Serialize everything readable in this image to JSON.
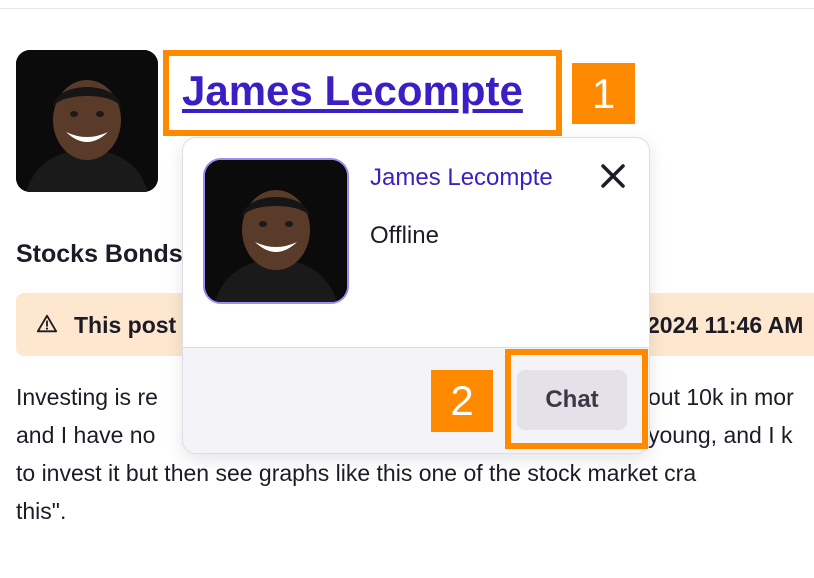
{
  "profile": {
    "author_name": "James Lecompte",
    "avatar_alt": "Portrait of James Lecompte"
  },
  "post": {
    "title": "Stocks Bonds",
    "warning_text": "This post",
    "warning_date": "2024 11:46 AM",
    "body_lines": [
      "Investing is re",
      "out 10k in mor",
      "and I have no",
      "young, and I k",
      "to invest it but then see graphs like this one of the stock market cra",
      "this\"."
    ]
  },
  "popup": {
    "name": "James Lecompte",
    "status": "Offline",
    "chat_label": "Chat"
  },
  "annotations": {
    "one": "1",
    "two": "2",
    "color": "#ff8a00"
  },
  "colors": {
    "link": "#3b1fc4",
    "warning_bg": "#fde7cf",
    "avatar_border": "#9e8bf0"
  }
}
